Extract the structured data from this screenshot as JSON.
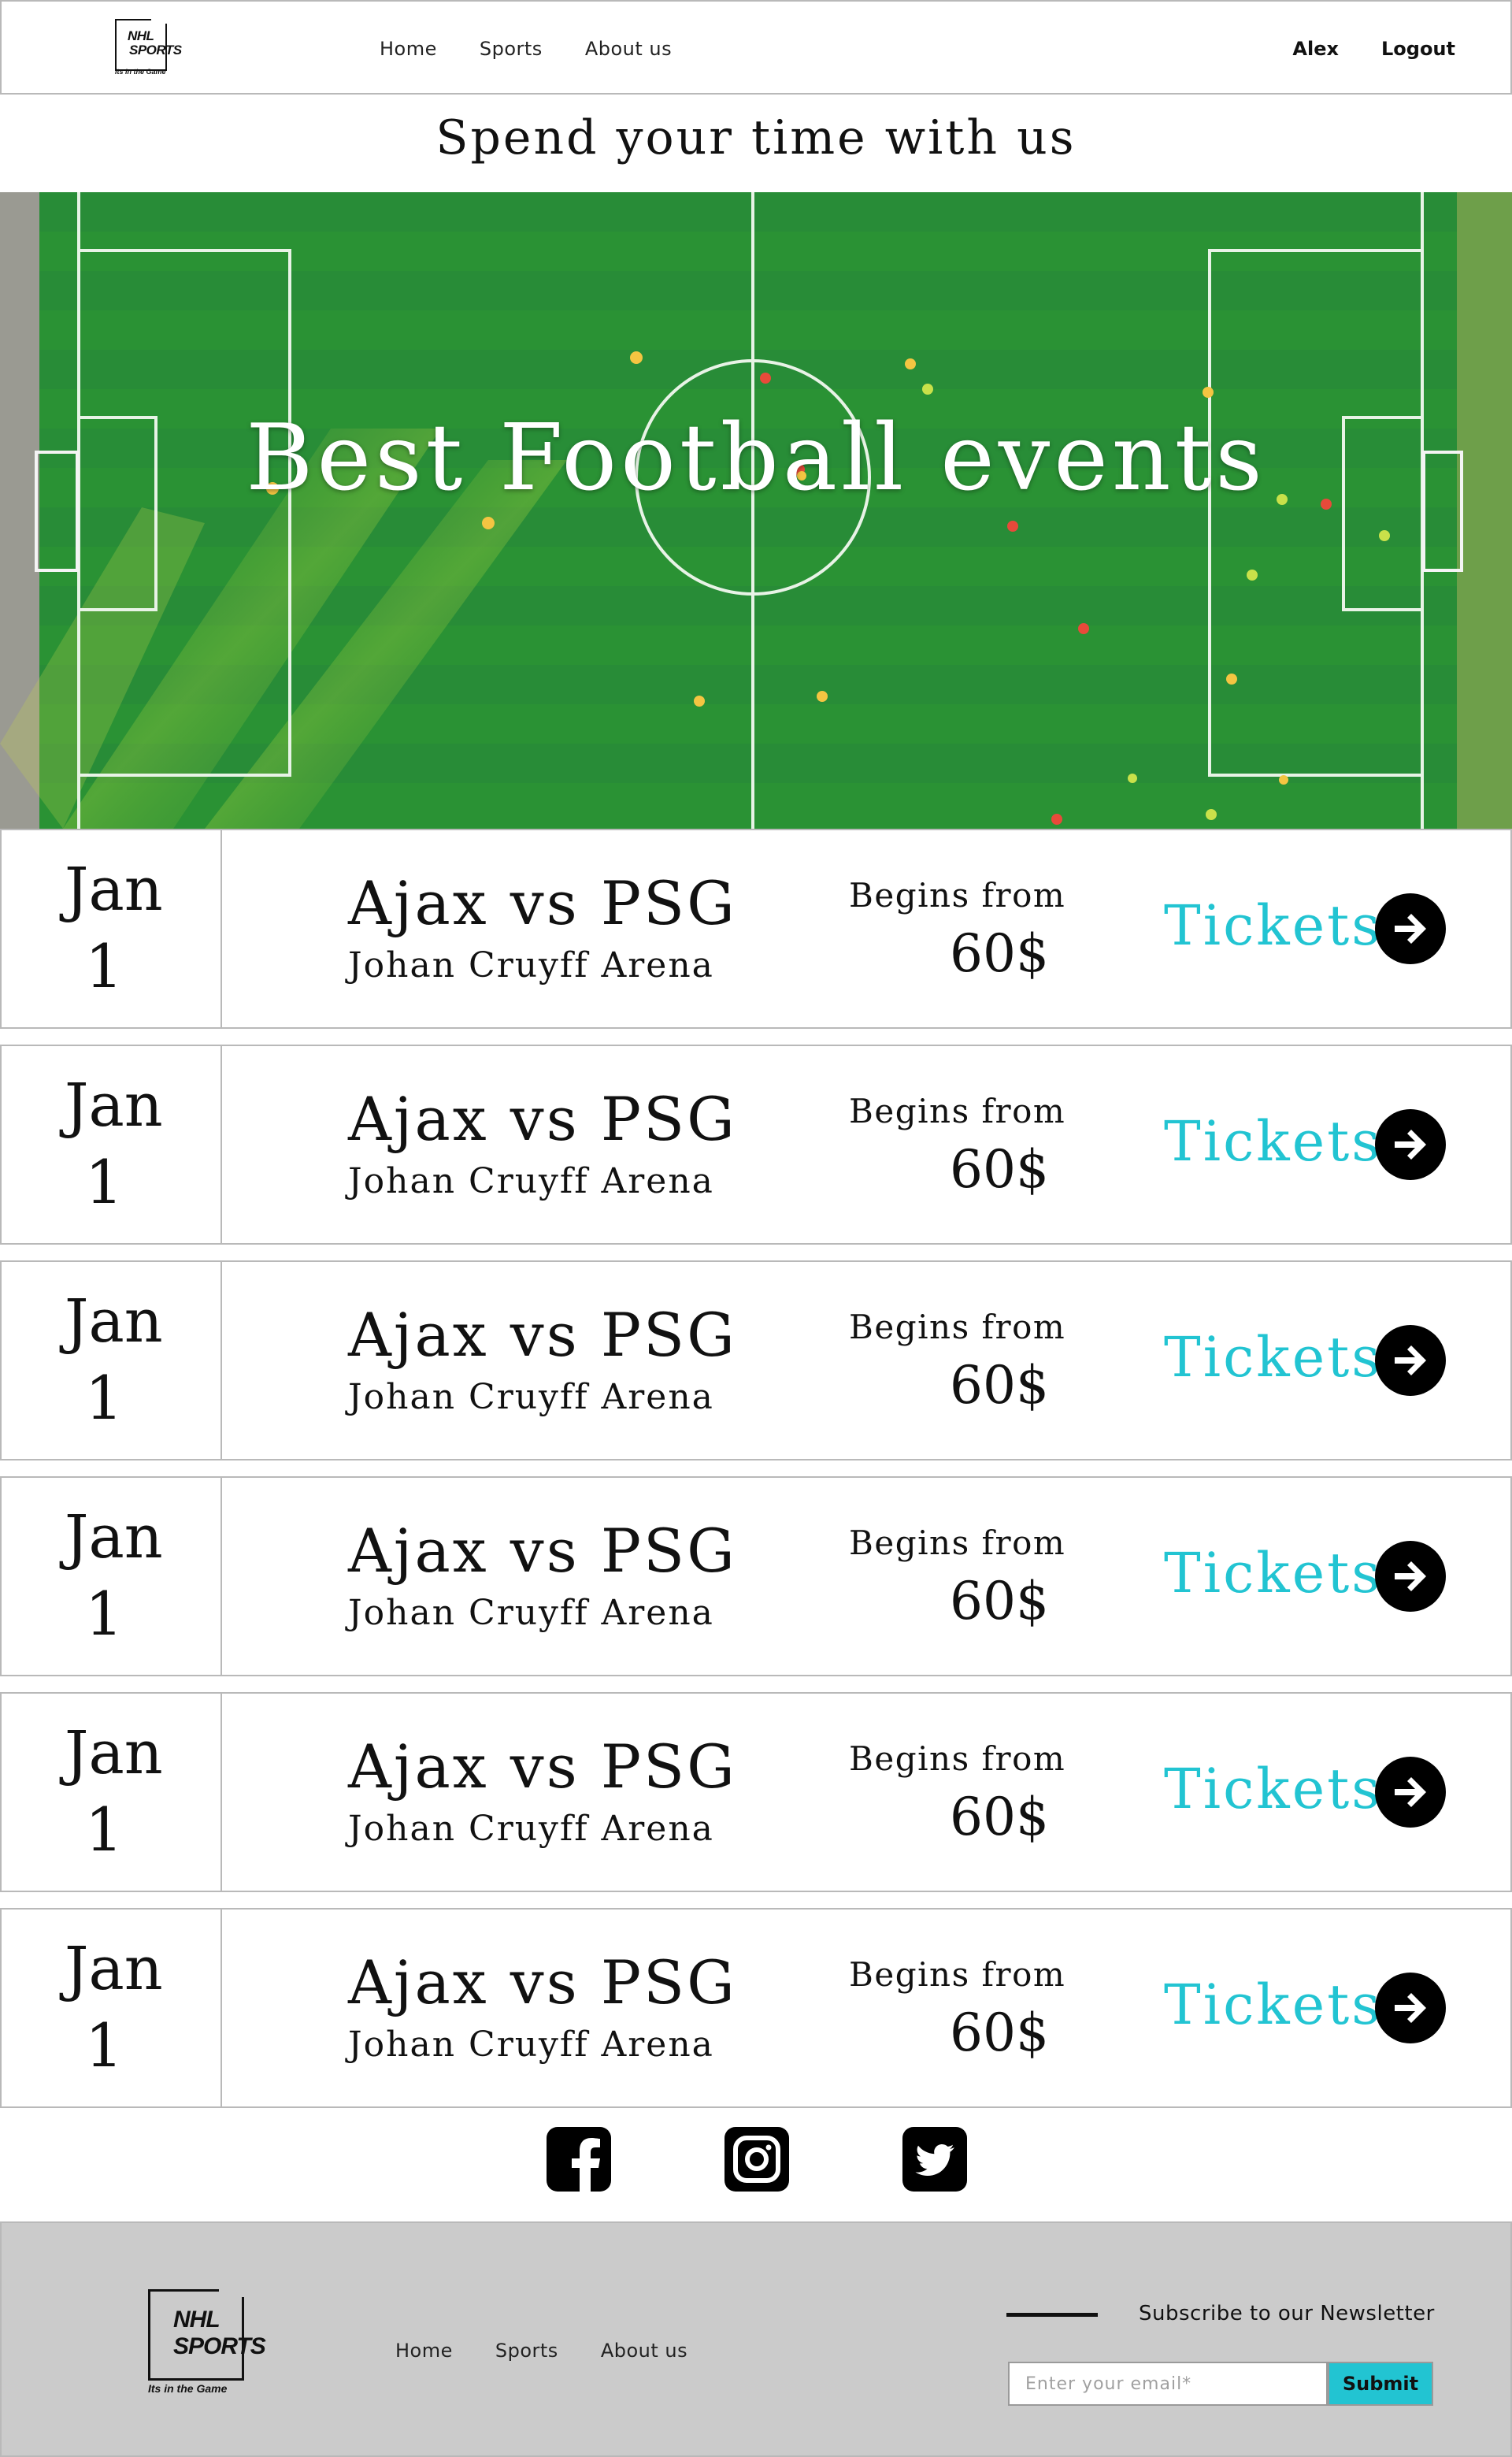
{
  "brand": {
    "logo_line1": "NHL",
    "logo_line2": "SPORTS",
    "logo_slogan": "Its in the Game"
  },
  "header": {
    "nav": [
      "Home",
      "Sports",
      "About us"
    ],
    "user_name": "Alex",
    "logout_label": "Logout"
  },
  "tagline": "Spend your time with us",
  "hero": {
    "title": "Best Football events"
  },
  "events": [
    {
      "month": "Jan",
      "day": "1",
      "match": "Ajax vs PSG",
      "venue": "Johan Cruyff Arena",
      "price_label": "Begins from",
      "price": "60$",
      "tickets_label": "Tickets"
    },
    {
      "month": "Jan",
      "day": "1",
      "match": "Ajax vs PSG",
      "venue": "Johan Cruyff Arena",
      "price_label": "Begins from",
      "price": "60$",
      "tickets_label": "Tickets"
    },
    {
      "month": "Jan",
      "day": "1",
      "match": "Ajax vs PSG",
      "venue": "Johan Cruyff Arena",
      "price_label": "Begins from",
      "price": "60$",
      "tickets_label": "Tickets"
    },
    {
      "month": "Jan",
      "day": "1",
      "match": "Ajax vs PSG",
      "venue": "Johan Cruyff Arena",
      "price_label": "Begins from",
      "price": "60$",
      "tickets_label": "Tickets"
    },
    {
      "month": "Jan",
      "day": "1",
      "match": "Ajax vs PSG",
      "venue": "Johan Cruyff Arena",
      "price_label": "Begins from",
      "price": "60$",
      "tickets_label": "Tickets"
    },
    {
      "month": "Jan",
      "day": "1",
      "match": "Ajax vs PSG",
      "venue": "Johan Cruyff Arena",
      "price_label": "Begins from",
      "price": "60$",
      "tickets_label": "Tickets"
    }
  ],
  "social": {
    "icons": [
      "facebook-icon",
      "instagram-icon",
      "twitter-icon"
    ]
  },
  "footer": {
    "nav": [
      "Home",
      "Sports",
      "About us"
    ],
    "newsletter_title": "Subscribe to our Newsletter",
    "email_placeholder": "Enter your email*",
    "submit_label": "Submit"
  },
  "colors": {
    "accent": "#22c4d2",
    "border": "#b9b9b9",
    "footer_bg": "#cbcbcb",
    "pitch_green": "#2d8c36"
  }
}
